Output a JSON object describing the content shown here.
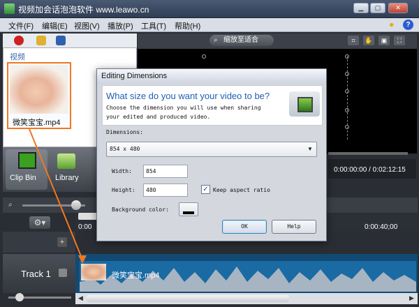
{
  "window": {
    "title": "视频加会话泡泡软件 www.leawo.cn"
  },
  "menu": [
    "文件(F)",
    "编辑(E)",
    "视图(V)",
    "播放(P)",
    "工具(T)",
    "帮助(H)"
  ],
  "left_panel": {
    "section_label": "视频",
    "clip_name": "微笑宝宝.mp4"
  },
  "bin_tabs": {
    "clip_bin": "Clip Bin",
    "library": "Library"
  },
  "preview": {
    "zoom_label": "缩放至适合",
    "time": "0:00:00:00 / 0:02:12:15"
  },
  "timeline": {
    "tick_start": "0:00",
    "tick_end": "0:00:40;00",
    "track_label": "Track 1",
    "clip_label": "微笑宝宝.mp4"
  },
  "dialog": {
    "title": "Editing Dimensions",
    "question": "What size do you want your video to be?",
    "desc_line1": "Choose the dimension you will use when sharing",
    "desc_line2": "your edited and produced video.",
    "dimensions_label": "Dimensions:",
    "dimensions_value": "854 x 480",
    "width_label": "Width:",
    "width_value": "854",
    "height_label": "Height:",
    "height_value": "480",
    "keep_aspect_label": "Keep aspect ratio",
    "keep_aspect_checked": true,
    "bg_color_label": "Background color:",
    "ok_label": "OK",
    "help_label": "Help"
  },
  "colors": {
    "accent_orange": "#f07820",
    "dialog_title_blue": "#2060b0",
    "track_blue": "#134a74"
  }
}
